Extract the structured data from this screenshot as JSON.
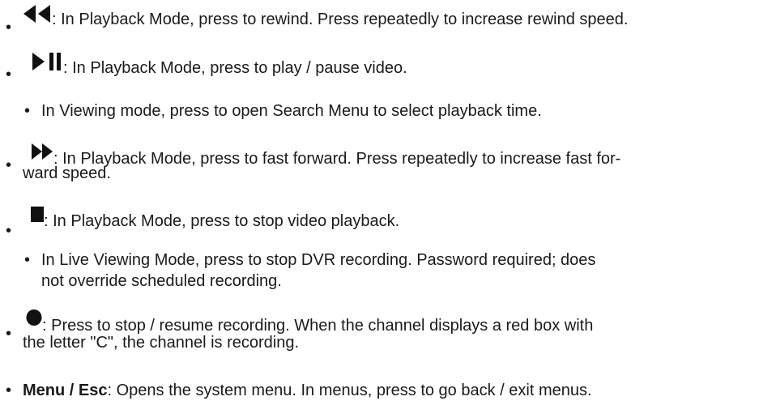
{
  "bullet_char": "•",
  "items": [
    {
      "icon": "rewind-icon",
      "text": ": In Playback Mode, press to rewind. Press repeatedly to increase rewind speed."
    },
    {
      "icon": "play-pause-icon",
      "text": ": In Playback Mode, press to play / pause video.",
      "sub": "In Viewing mode, press to open Search Menu to select playback time."
    },
    {
      "icon": "fast-forward-icon",
      "text_line1": ": In Playback Mode, press to fast forward. Press repeatedly to increase fast for-",
      "text_line2": "ward speed."
    },
    {
      "icon": "stop-icon",
      "text": ": In Playback Mode, press to stop video playback.",
      "sub_line1": "In Live Viewing Mode, press to stop DVR recording. Password required; does",
      "sub_line2": "not override scheduled recording."
    },
    {
      "icon": "record-icon",
      "text_line1": ": Press to stop / resume recording. When the channel displays a red box with",
      "text_line2": "the letter \"C\", the channel is recording."
    },
    {
      "label": "Menu / Esc",
      "text": ": Opens the system menu. In menus, press to go back / exit menus."
    }
  ]
}
